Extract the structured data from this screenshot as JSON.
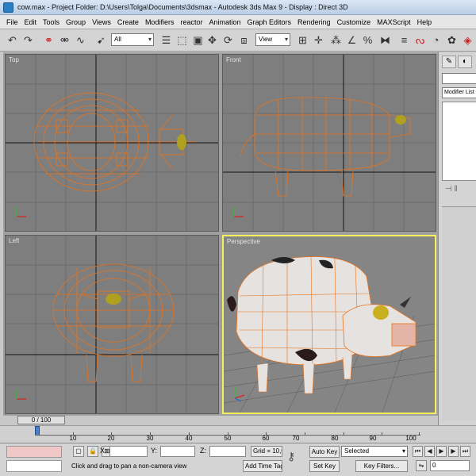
{
  "window": {
    "title": "cow.max    - Project Folder: D:\\Users\\Tolga\\Documents\\3dsmax    - Autodesk 3ds Max 9    - Display : Direct 3D"
  },
  "menu": {
    "items": [
      "File",
      "Edit",
      "Tools",
      "Group",
      "Views",
      "Create",
      "Modifiers",
      "reactor",
      "Animation",
      "Graph Editors",
      "Rendering",
      "Customize",
      "MAXScript",
      "Help"
    ]
  },
  "toolbar": {
    "selection_filter": "All",
    "reference_coord": "View"
  },
  "viewports": {
    "top": {
      "label": "Top"
    },
    "front": {
      "label": "Front"
    },
    "left": {
      "label": "Left"
    },
    "perspective": {
      "label": "Perspective"
    }
  },
  "command_panel": {
    "modifier_list": "Modifier List"
  },
  "time_slider": {
    "position": "0 / 100"
  },
  "track_bar": {
    "ticks": [
      "10",
      "20",
      "30",
      "40",
      "50",
      "60",
      "70",
      "80",
      "90",
      "100"
    ]
  },
  "status_bar": {
    "x_label": "X:",
    "y_label": "Y:",
    "z_label": "Z:",
    "grid": "Grid = 10,0",
    "prompt": "Click and drag to pan a non-camera view",
    "add_time_tag": "Add Time Tag",
    "auto_key": "Auto Key",
    "set_key": "Set Key",
    "key_mode": "Selected",
    "key_filters": "Key Filters...",
    "current_frame": "0"
  },
  "colors": {
    "wireframe": "#e8731c",
    "active_viewport_border": "#f6f05c",
    "viewport_bg": "#7e7e7e"
  }
}
